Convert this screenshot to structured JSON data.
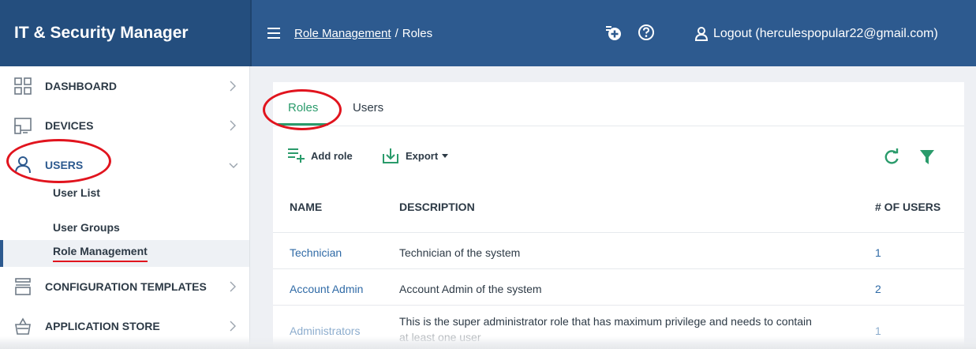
{
  "brand": "IT & Security Manager",
  "breadcrumb": {
    "parent": "Role Management",
    "sep": "/",
    "current": "Roles"
  },
  "logout": "Logout (herculespopular22@gmail.com)",
  "sidebar": {
    "items": [
      {
        "label": "DASHBOARD",
        "icon": "dashboard-icon"
      },
      {
        "label": "DEVICES",
        "icon": "devices-icon"
      },
      {
        "label": "USERS",
        "icon": "user-icon"
      },
      {
        "label": "CONFIGURATION TEMPLATES",
        "icon": "templates-icon"
      },
      {
        "label": "APPLICATION STORE",
        "icon": "store-icon"
      }
    ],
    "sub": [
      "User List",
      "User Groups",
      "Role Management"
    ]
  },
  "tabs": [
    "Roles",
    "Users"
  ],
  "toolbar": {
    "add": "Add role",
    "export": "Export"
  },
  "table": {
    "headers": [
      "NAME",
      "DESCRIPTION",
      "# OF USERS"
    ],
    "rows": [
      {
        "name": "Technician",
        "description": "Technician of the system",
        "count": "1"
      },
      {
        "name": "Account Admin",
        "description": "Account Admin of the system",
        "count": "2"
      },
      {
        "name": "Administrators",
        "description": "This is the super administrator role that has maximum privilege and needs to contain",
        "description2": "at least one user",
        "count": "1"
      }
    ]
  },
  "colors": {
    "header": "#2d5a8f",
    "accent": "#2a9b6b",
    "link": "#2f6aa6",
    "highlight": "#e1141e"
  }
}
